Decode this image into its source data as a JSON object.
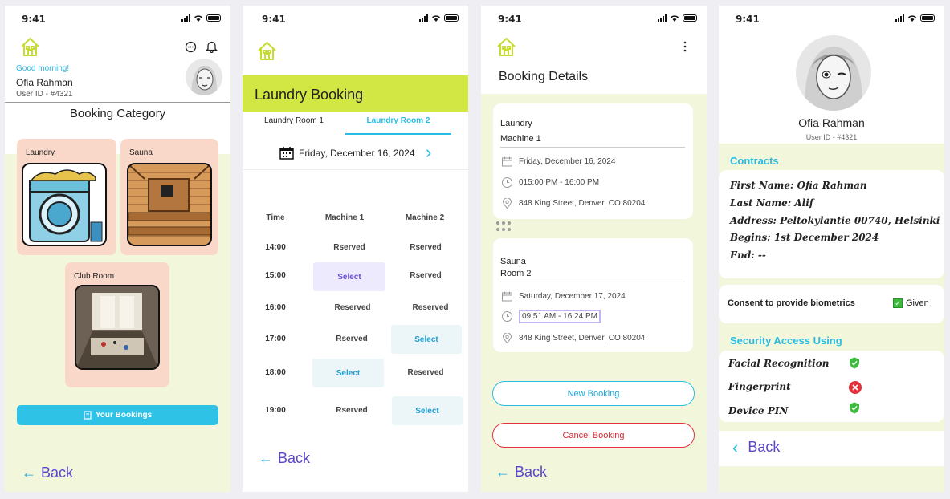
{
  "status_time": "9:41",
  "screen1": {
    "greeting": "Good morning!",
    "user_name": "Ofia Rahman",
    "user_id": "User ID - #4321",
    "section_title": "Booking Category",
    "categories": [
      {
        "label": "Laundry"
      },
      {
        "label": "Sauna"
      },
      {
        "label": "Club Room"
      }
    ],
    "bookings_button": "Your Bookings",
    "back": "Back",
    "icons": [
      "home-icon",
      "chat-icon",
      "bell-icon"
    ]
  },
  "screen2": {
    "title": "Laundry Booking",
    "tabs": [
      "Laundry Room 1",
      "Laundry Room 2"
    ],
    "active_tab": "Laundry Room 2",
    "date": "Friday, December 16, 2024",
    "columns": [
      "Time",
      "Machine 1",
      "Machine 2"
    ],
    "rows": [
      {
        "time": "14:00",
        "m1": "Rserved",
        "m2": "Rserved"
      },
      {
        "time": "15:00",
        "m1": "Select",
        "m2": "Rserved"
      },
      {
        "time": "16:00",
        "m1": "Reserved",
        "m2": "Reserved"
      },
      {
        "time": "17:00",
        "m1": "Rserved",
        "m2": "Select"
      },
      {
        "time": "18:00",
        "m1": "Select",
        "m2": "Reserved"
      },
      {
        "time": "19:00",
        "m1": "Rserved",
        "m2": "Select"
      }
    ],
    "back": "Back"
  },
  "screen3": {
    "title": "Booking Details",
    "bookings": [
      {
        "category": "Laundry",
        "unit": "Machine 1",
        "date": "Friday, December 16, 2024",
        "time": "015:00 PM - 16:00 PM",
        "address": "848 King Street, Denver, CO 80204"
      },
      {
        "category": "Sauna",
        "unit": "Room 2",
        "date": "Saturday, December 17, 2024",
        "time": "09:51 AM - 16:24 PM",
        "address": "848 King Street, Denver, CO 80204"
      }
    ],
    "new_booking": "New Booking",
    "cancel_booking": "Cancel Booking",
    "back": "Back"
  },
  "screen4": {
    "user_name": "Ofia Rahman",
    "user_id": "User ID - #4321",
    "contracts_title": "Contracts",
    "contracts": [
      "First Name: Ofia Rahman",
      "Last Name: Alif",
      "Address: Peltokylantie 00740, Helsinki",
      "Begins: 1st December 2024",
      "End: --"
    ],
    "consent_label": "Consent to provide biometrics",
    "consent_value": "Given",
    "security_title": "Security Access Using",
    "security": [
      {
        "label": "Facial Recognition",
        "status": "enabled"
      },
      {
        "label": "Fingerprint",
        "status": "disabled"
      },
      {
        "label": "Device PIN",
        "status": "enabled"
      }
    ],
    "back": "Back"
  },
  "colors": {
    "accent_cyan": "#27bde4",
    "lime": "#d2e744",
    "peach": "#fad8c9",
    "cream": "#f2f7dc",
    "purple": "#5b45c9",
    "red": "#e2313b",
    "green": "#3dbb3d"
  }
}
